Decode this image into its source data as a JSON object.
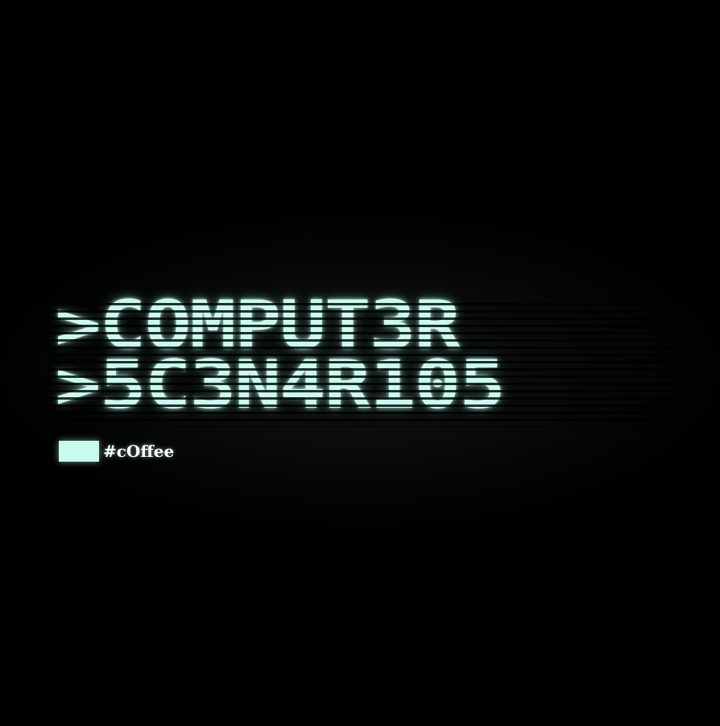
{
  "title": {
    "line1": ">COMPUT3R",
    "line2": ">5C3N4R105"
  },
  "footer": {
    "tag": "#cOffee"
  },
  "colors": {
    "background": "#000000",
    "phosphor": "#c8fbee",
    "tag_text": "#ffffff"
  },
  "icons": {
    "cursor": "terminal-cursor-block"
  }
}
